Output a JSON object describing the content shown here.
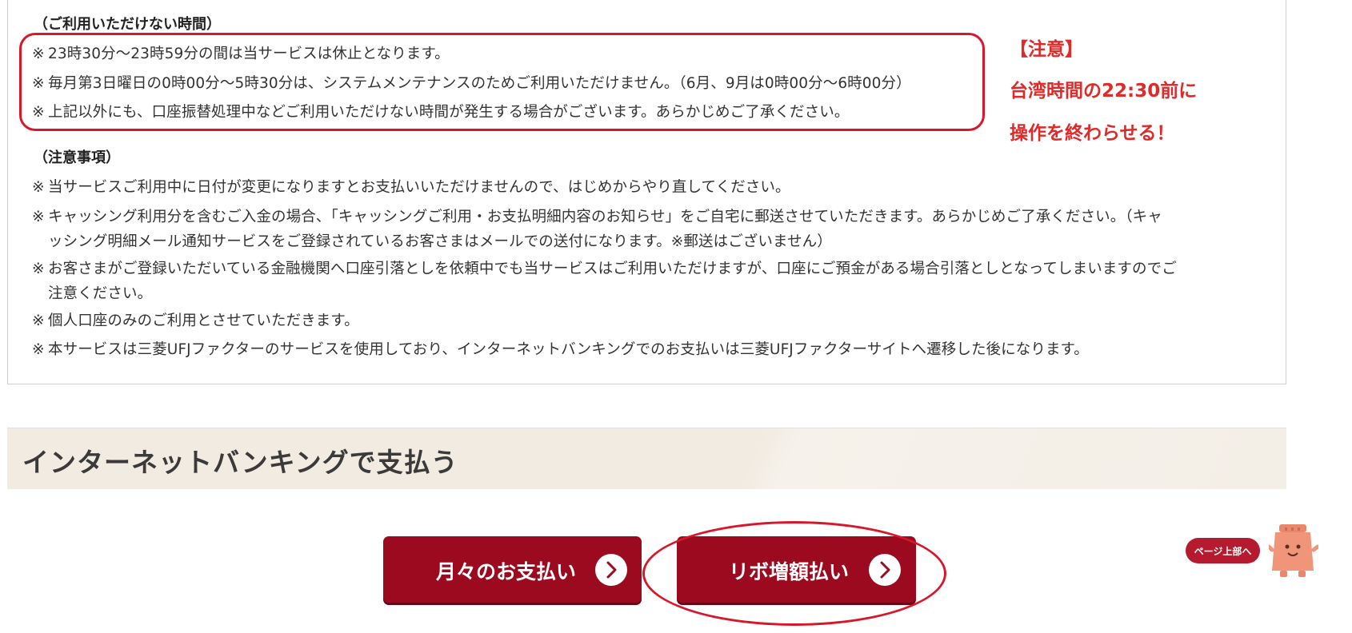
{
  "unavailable_hours": {
    "heading": "（ご利用いただけない時間）",
    "items": [
      "23時30分～23時59分の間は当サービスは休止となります。",
      "毎月第3日曜日の0時00分～5時30分は、システムメンテナンスのためご利用いただけません。（6月、9月は0時00分～6時00分）",
      "上記以外にも、口座振替処理中などご利用いただけない時間が発生する場合がございます。あらかじめご了承ください。"
    ]
  },
  "annotation": {
    "line1": "【注意】",
    "line2": "台湾時間の22:30前に",
    "line3": "操作を終わらせる！"
  },
  "cautions": {
    "heading": "（注意事項）",
    "items": [
      {
        "line1": "当サービスご利用中に日付が変更になりますとお支払いいただけませんので、はじめからやり直してください。"
      },
      {
        "line1": "キャッシング利用分を含むご入金の場合、「キャッシングご利用・お支払明細内容のお知らせ」をご自宅に郵送させていただきます。あらかじめご了承ください。（キャ",
        "line2": "ッシング明細メール通知サービスをご登録されているお客さまはメールでの送付になります。※郵送はございません）"
      },
      {
        "line1": "お客さまがご登録いただいている金融機関へ口座引落としを依頼中でも当サービスはご利用いただけますが、口座にご預金がある場合引落としとなってしまいますのでご",
        "line2": "注意ください。"
      },
      {
        "line1": "個人口座のみのご利用とさせていただきます。"
      },
      {
        "line1": "本サービスは三菱UFJファクターのサービスを使用しており、インターネットバンキングでのお支払いは三菱UFJファクターサイトへ遷移した後になります。"
      }
    ]
  },
  "mark": "※",
  "section": {
    "title": "インターネットバンキングで支払う"
  },
  "buttons": {
    "monthly": "月々のお支払い",
    "revolving": "リボ増額払い"
  },
  "page_top": {
    "label": "ページ上部へ"
  },
  "icons": {
    "button_arrow": "chevron-right-circle-icon",
    "mascot": "mascot-icon"
  },
  "colors": {
    "accent": "#9c0a1f",
    "annotation": "#e02a2a",
    "band": "#f1ebe1"
  }
}
